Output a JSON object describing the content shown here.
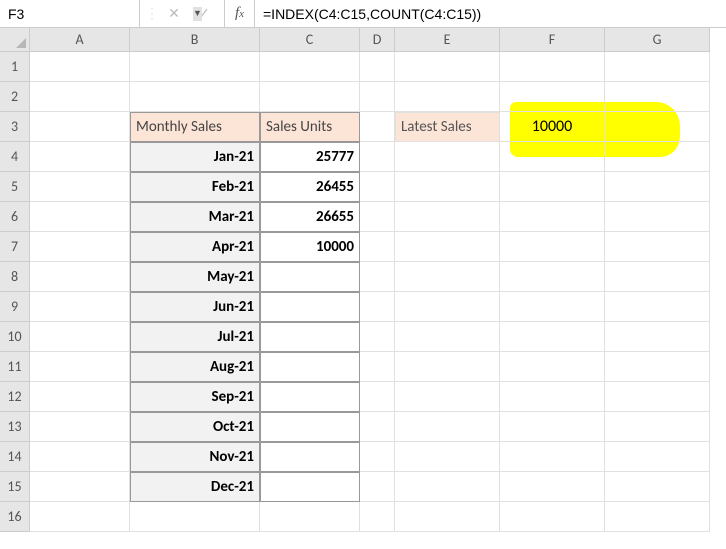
{
  "nameBox": "F3",
  "formula": "=INDEX(C4:C15,COUNT(C4:C15))",
  "columns": [
    "A",
    "B",
    "C",
    "D",
    "E",
    "F",
    "G"
  ],
  "rows": [
    "1",
    "2",
    "3",
    "4",
    "5",
    "6",
    "7",
    "8",
    "9",
    "10",
    "11",
    "12",
    "13",
    "14",
    "15",
    "16"
  ],
  "headers": {
    "b3": "Monthly Sales",
    "c3": "Sales Units",
    "e3": "Latest Sales"
  },
  "months": {
    "b4": "Jan-21",
    "b5": "Feb-21",
    "b6": "Mar-21",
    "b7": "Apr-21",
    "b8": "May-21",
    "b9": "Jun-21",
    "b10": "Jul-21",
    "b11": "Aug-21",
    "b12": "Sep-21",
    "b13": "Oct-21",
    "b14": "Nov-21",
    "b15": "Dec-21"
  },
  "sales": {
    "c4": "25777",
    "c5": "26455",
    "c6": "26655",
    "c7": "10000"
  },
  "result": {
    "f3": "10000"
  },
  "chart_data": {
    "type": "table",
    "title": "Monthly Sales / Sales Units",
    "columns": [
      "Monthly Sales",
      "Sales Units"
    ],
    "rows": [
      [
        "Jan-21",
        25777
      ],
      [
        "Feb-21",
        26455
      ],
      [
        "Mar-21",
        26655
      ],
      [
        "Apr-21",
        10000
      ],
      [
        "May-21",
        null
      ],
      [
        "Jun-21",
        null
      ],
      [
        "Jul-21",
        null
      ],
      [
        "Aug-21",
        null
      ],
      [
        "Sep-21",
        null
      ],
      [
        "Oct-21",
        null
      ],
      [
        "Nov-21",
        null
      ],
      [
        "Dec-21",
        null
      ]
    ],
    "derived": {
      "Latest Sales": 10000
    }
  }
}
